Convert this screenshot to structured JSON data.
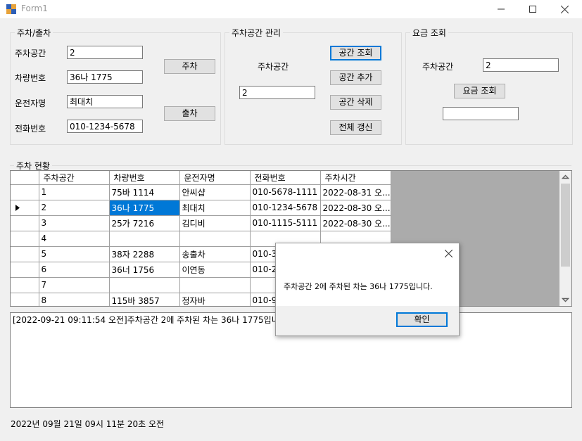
{
  "window": {
    "title": "Form1"
  },
  "parking": {
    "title": "주차/출차",
    "space_label": "주차공간",
    "space_value": "2",
    "car_label": "차량번호",
    "car_value": "36나 1775",
    "driver_label": "운전자명",
    "driver_value": "최대치",
    "phone_label": "전화번호",
    "phone_value": "010-1234-5678",
    "park_button": "주차",
    "exit_button": "출차"
  },
  "space_mgmt": {
    "title": "주차공간 관리",
    "space_label": "주차공간",
    "space_value": "2",
    "lookup_button": "공간 조회",
    "add_button": "공간 추가",
    "delete_button": "공간 삭제",
    "refresh_button": "전체 갱신"
  },
  "fee": {
    "title": "요금 조회",
    "space_label": "주차공간",
    "space_value": "2",
    "lookup_button": "요금 조회",
    "result_value": ""
  },
  "status_group": {
    "title": "주차 현황"
  },
  "grid": {
    "columns": [
      "주차공간",
      "차량번호",
      "운전자명",
      "전화번호",
      "주차시간"
    ],
    "rows": [
      [
        "1",
        "75바 1114",
        "안씨샵",
        "010-5678-1111",
        "2022-08-31 오..."
      ],
      [
        "2",
        "36나 1775",
        "최대치",
        "010-1234-5678",
        "2022-08-30 오..."
      ],
      [
        "3",
        "25가 7216",
        "김디비",
        "010-1115-5111",
        "2022-08-30 오..."
      ],
      [
        "4",
        "",
        "",
        "",
        ""
      ],
      [
        "5",
        "38자 2288",
        "송출차",
        "010-33",
        ""
      ],
      [
        "6",
        "36너 1756",
        "이연동",
        "010-22",
        ""
      ],
      [
        "7",
        "",
        "",
        "",
        ""
      ],
      [
        "8",
        "115바 3857",
        "정자바",
        "010-98",
        ""
      ]
    ]
  },
  "log": {
    "lines": [
      "[2022-09-21 09:11:54 오전]주차공간 2에 주차된 차는 36나 1775입니다"
    ]
  },
  "status_bar": {
    "text": "2022년 09월 21일 09시 11분 20초 오전"
  },
  "dialog": {
    "message": "주차공간 2에 주차된 차는 36나 1775입니다.",
    "ok_button": "확인"
  }
}
